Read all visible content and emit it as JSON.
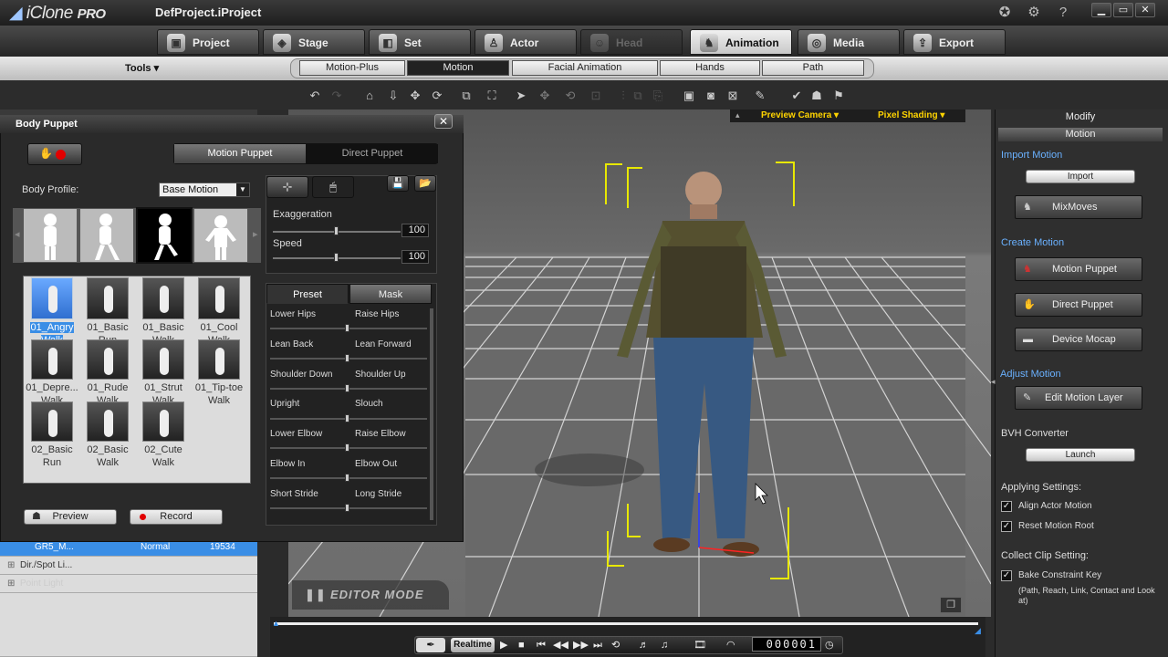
{
  "app": {
    "logo": "iClone",
    "edition": "PRO",
    "project": "DefProject.iProject"
  },
  "main_tabs": [
    {
      "label": "Project",
      "icon": "project-icon",
      "glyph": "▣"
    },
    {
      "label": "Stage",
      "icon": "stage-icon",
      "glyph": "◈"
    },
    {
      "label": "Set",
      "icon": "set-icon",
      "glyph": "◧"
    },
    {
      "label": "Actor",
      "icon": "actor-icon",
      "glyph": "♙"
    },
    {
      "label": "Head",
      "icon": "head-icon",
      "glyph": "☺"
    },
    {
      "label": "Animation",
      "icon": "animation-icon",
      "glyph": "♞"
    },
    {
      "label": "Media",
      "icon": "media-icon",
      "glyph": "◎"
    },
    {
      "label": "Export",
      "icon": "export-icon",
      "glyph": "⇪"
    }
  ],
  "tools_label": "Tools ▾",
  "sub_tabs": [
    "Motion-Plus",
    "Motion",
    "Facial Animation",
    "Hands",
    "Path"
  ],
  "viewport": {
    "camera": "Preview Camera",
    "shading": "Pixel Shading",
    "mode": "EDITOR MODE"
  },
  "scene_rows": [
    {
      "name": "GR5_M...",
      "mode": "Normal",
      "value": "19534"
    },
    {
      "name": "Dir./Spot Li..."
    },
    {
      "name": "Point Light"
    }
  ],
  "playback": {
    "realtime": "Realtime",
    "frame": "000001"
  },
  "body_puppet": {
    "title": "Body Puppet",
    "tab_motion": "Motion Puppet",
    "tab_direct": "Direct Puppet",
    "body_profile_label": "Body Profile:",
    "body_profile_value": "Base Motion",
    "exaggeration_label": "Exaggeration",
    "exaggeration_value": "100",
    "speed_label": "Speed",
    "speed_value": "100",
    "preset_tab": "Preset",
    "mask_tab": "Mask",
    "presets": [
      [
        "Lower Hips",
        "Raise Hips"
      ],
      [
        "Lean Back",
        "Lean Forward"
      ],
      [
        "Shoulder Down",
        "Shoulder Up"
      ],
      [
        "Upright",
        "Slouch"
      ],
      [
        "Lower Elbow",
        "Raise Elbow"
      ],
      [
        "Elbow In",
        "Elbow Out"
      ],
      [
        "Short Stride",
        "Long Stride"
      ]
    ],
    "motions": [
      [
        "01_Angry",
        "Walk"
      ],
      [
        "01_Basic",
        "Run"
      ],
      [
        "01_Basic",
        "Walk"
      ],
      [
        "01_Cool",
        "Walk"
      ],
      [
        "01_Depre...",
        "Walk"
      ],
      [
        "01_Rude",
        "Walk"
      ],
      [
        "01_Strut",
        "Walk"
      ],
      [
        "01_Tip-toe",
        "Walk"
      ],
      [
        "02_Basic",
        "Run"
      ],
      [
        "02_Basic",
        "Walk"
      ],
      [
        "02_Cute",
        "Walk"
      ]
    ],
    "preview_label": "Preview",
    "record_label": "Record"
  },
  "modify": {
    "title": "Modify",
    "section": "Motion",
    "import_motion": "Import Motion",
    "import_btn": "Import",
    "mixmoves": "MixMoves",
    "create_motion": "Create Motion",
    "motion_puppet": "Motion Puppet",
    "direct_puppet": "Direct Puppet",
    "device_mocap": "Device Mocap",
    "adjust_motion": "Adjust Motion",
    "edit_motion_layer": "Edit Motion Layer",
    "bvh_converter": "BVH Converter",
    "launch": "Launch",
    "applying_settings": "Applying Settings:",
    "align_actor_motion": "Align Actor Motion",
    "reset_motion_root": "Reset Motion Root",
    "collect_clip": "Collect Clip Setting:",
    "bake_constraint": "Bake Constraint Key",
    "bake_note": "(Path, Reach, Link, Contact and Look at)"
  },
  "colors": {
    "accent": "#3a8ee6",
    "highlight": "#ffd400",
    "record": "#e10000"
  }
}
